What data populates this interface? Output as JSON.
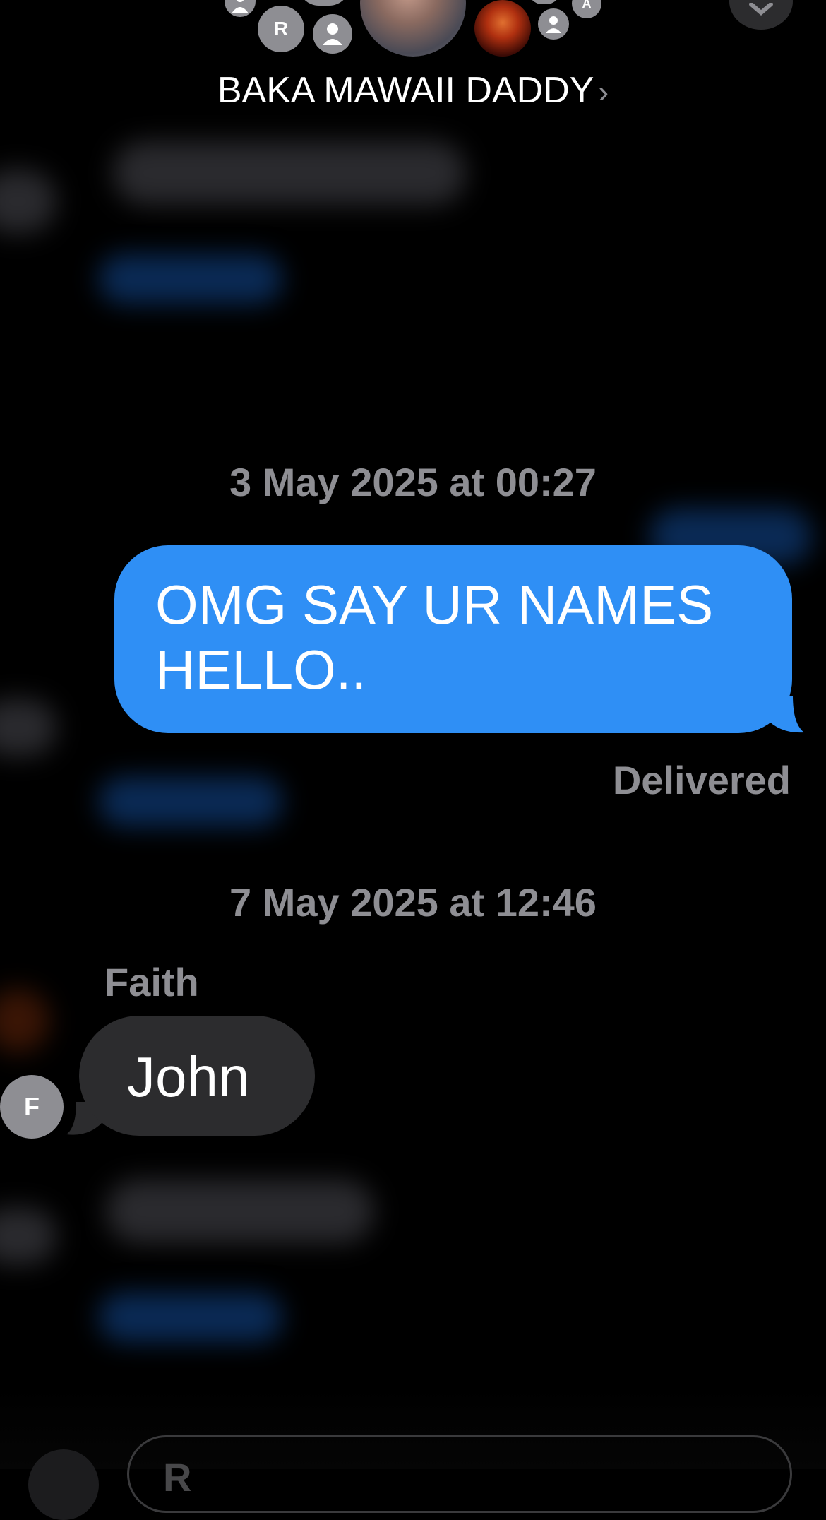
{
  "header": {
    "title": "BAKA MAWAII DADDY",
    "avatars": [
      {
        "initial": "R"
      },
      {
        "initial": "A"
      }
    ]
  },
  "messages": {
    "timestamp_1": "3 May 2025 at 00:27",
    "outgoing_text_line1": "OMG SAY UR NAMES",
    "outgoing_text_line2": "HELLO..",
    "status": "Delivered",
    "timestamp_2": "7 May 2025 at 12:46",
    "sender_name": "Faith",
    "sender_initial": "F",
    "incoming_text": "John"
  },
  "compose": {
    "placeholder": "R"
  },
  "colors": {
    "outgoing_bubble": "#2f8ff5",
    "incoming_bubble": "#2c2c2e",
    "secondary_text": "#8e8e93",
    "background": "#000000"
  }
}
